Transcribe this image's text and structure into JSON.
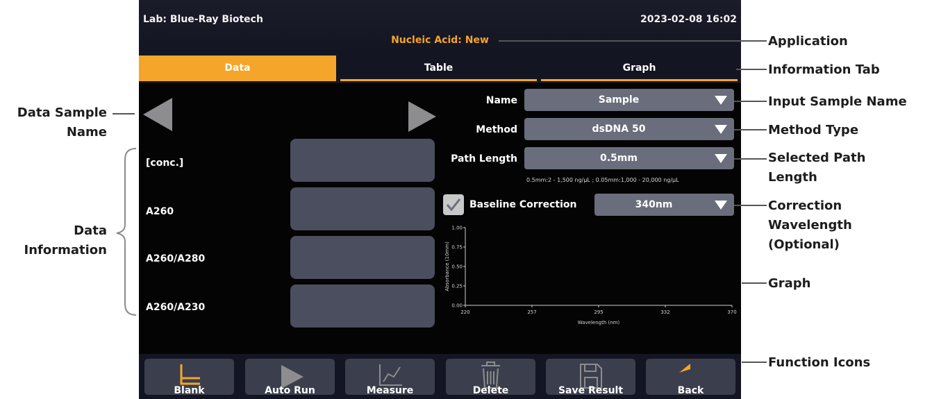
{
  "topbar": {
    "lab": "Lab: Blue-Ray Biotech",
    "datetime": "2023-02-08 16:02",
    "application": "Nucleic Acid: New"
  },
  "tabs": [
    {
      "label": "Data",
      "active": true
    },
    {
      "label": "Table",
      "active": false
    },
    {
      "label": "Graph",
      "active": false
    }
  ],
  "data_panel": {
    "rows": [
      {
        "label": "[conc.]",
        "value": ""
      },
      {
        "label": "A260",
        "value": ""
      },
      {
        "label": "A260/A280",
        "value": ""
      },
      {
        "label": "A260/A230",
        "value": ""
      }
    ]
  },
  "form": {
    "name_label": "Name",
    "name_value": "Sample",
    "method_label": "Method",
    "method_value": "dsDNA 50",
    "path_label": "Path Length",
    "path_value": "0.5mm",
    "range_note": "0.5mm:2 - 1,500 ng/μL ; 0.05mm:1,000 - 20,000 ng/μL",
    "baseline_label": "Baseline Correction",
    "baseline_checked": true,
    "baseline_value": "340nm"
  },
  "graph": {
    "ylabel": "Absorbance (10mm)",
    "xlabel": "Wavelength (nm)",
    "yticks": [
      "0.00",
      "0.25",
      "0.50",
      "0.75",
      "1.00"
    ],
    "xticks": [
      "220",
      "257",
      "295",
      "332",
      "370"
    ]
  },
  "functions": [
    {
      "label": "Blank",
      "icon": "blank-axis-icon"
    },
    {
      "label": "Auto Run",
      "icon": "play-icon"
    },
    {
      "label": "Measure",
      "icon": "measure-graph-icon"
    },
    {
      "label": "Delete",
      "icon": "trash-icon"
    },
    {
      "label": "Save Result",
      "icon": "save-floppy-icon"
    },
    {
      "label": "Back",
      "icon": "back-arrow-icon"
    }
  ],
  "annotations": {
    "application": "Application",
    "information_tab": "Information Tab",
    "input_sample_name": "Input Sample Name",
    "method_type": "Method Type",
    "selected_path_length_1": "Selected Path",
    "selected_path_length_2": "Length",
    "correction_1": "Correction",
    "correction_2": "Wavelength",
    "correction_3": "(Optional)",
    "graph": "Graph",
    "function_icons": "Function Icons",
    "data_sample_name_1": "Data Sample",
    "data_sample_name_2": "Name",
    "data_information_1": "Data",
    "data_information_2": "Information"
  },
  "colors": {
    "accent": "#f5a52a",
    "screen_bg": "#040405",
    "panel": "#4b4e5e",
    "dropdown": "#6a6d7b"
  }
}
